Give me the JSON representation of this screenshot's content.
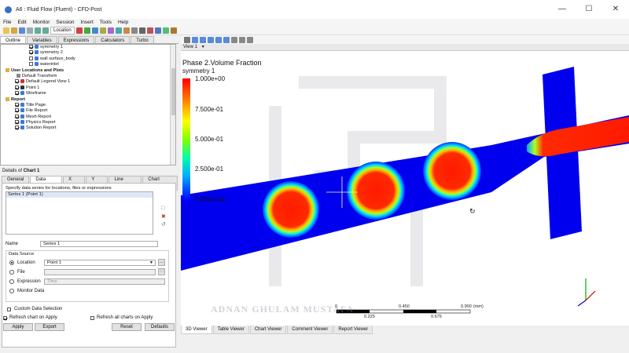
{
  "window": {
    "title": "A6 : Fluid Flow (Fluent) - CFD-Post"
  },
  "menu": [
    "File",
    "Edit",
    "Monitor",
    "Session",
    "Insert",
    "Tools",
    "Help"
  ],
  "toolbar": {
    "location_label": "Location"
  },
  "outline_tabs": [
    "Outline",
    "Variables",
    "Expressions",
    "Calculators",
    "Turbo"
  ],
  "tree": [
    {
      "label": "symmetry 1",
      "indent": 3,
      "checked": true,
      "icon": "#3a7bd5"
    },
    {
      "label": "symmetry 2",
      "indent": 3,
      "checked": true,
      "icon": "#3a7bd5"
    },
    {
      "label": "wall surface_body",
      "indent": 3,
      "checked": false,
      "icon": "#3a7bd5"
    },
    {
      "label": "waterinlet",
      "indent": 3,
      "checked": false,
      "icon": "#3a7bd5"
    },
    {
      "label": "User Locations and Plots",
      "indent": 0,
      "folder": true,
      "bold": true
    },
    {
      "label": "Default Transform",
      "indent": 1,
      "icon": "#888"
    },
    {
      "label": "Default Legend View 1",
      "indent": 1,
      "checked": true,
      "icon": "#c33"
    },
    {
      "label": "Point 1",
      "indent": 1,
      "checked": true,
      "icon": "#333"
    },
    {
      "label": "Wireframe",
      "indent": 1,
      "checked": true,
      "icon": "#3a7bd5"
    },
    {
      "label": "Report",
      "indent": 0,
      "folder": true,
      "bold": true
    },
    {
      "label": "Title Page",
      "indent": 1,
      "checked": true,
      "icon": "#3a7bd5"
    },
    {
      "label": "File Report",
      "indent": 1,
      "checked": true,
      "icon": "#3a7bd5"
    },
    {
      "label": "Mesh Report",
      "indent": 1,
      "checked": true,
      "icon": "#3a7bd5"
    },
    {
      "label": "Physics Report",
      "indent": 1,
      "checked": true,
      "icon": "#3a7bd5"
    },
    {
      "label": "Solution Report",
      "indent": 1,
      "checked": true,
      "icon": "#3a7bd5"
    }
  ],
  "details": {
    "title_prefix": "Details of",
    "title_obj": "Chart 1",
    "tabs": [
      "General",
      "Data Series",
      "X Axis",
      "Y Axis",
      "Line Display",
      "Chart Display"
    ],
    "specify": "Specify data series for locations, files or expressions",
    "series_item": "Series 1 (Point 1)",
    "name_label": "Name",
    "name_value": "Series 1",
    "data_source": "Data Source",
    "location_label": "Location",
    "location_value": "Point 1",
    "file_label": "File",
    "expression_label": "Expression",
    "expression_value": "Time",
    "monitor_label": "Monitor Data",
    "custom_label": "Custom Data Selection",
    "refresh_chart": "Refresh chart on Apply",
    "refresh_all": "Refresh all charts on Apply",
    "buttons": {
      "apply": "Apply",
      "export": "Export",
      "reset": "Reset",
      "defaults": "Defaults"
    }
  },
  "viewport": {
    "view_label": "View 1",
    "legend": {
      "title": "Phase 2.Volume Fraction",
      "subtitle": "symmetry 1",
      "labels": [
        "1.000e+00",
        "7.500e-01",
        "5.000e-01",
        "2.500e-01",
        "0.000e+00"
      ]
    },
    "scale": {
      "ticks_top": [
        "0",
        "0.450",
        "0.900"
      ],
      "unit": "(mm)",
      "ticks_bottom": [
        "0.225",
        "0.675"
      ]
    },
    "watermark": "ADNAN GHULAM MUSTAFA"
  },
  "bottom_tabs": [
    "3D Viewer",
    "Table Viewer",
    "Chart Viewer",
    "Comment Viewer",
    "Report Viewer"
  ]
}
